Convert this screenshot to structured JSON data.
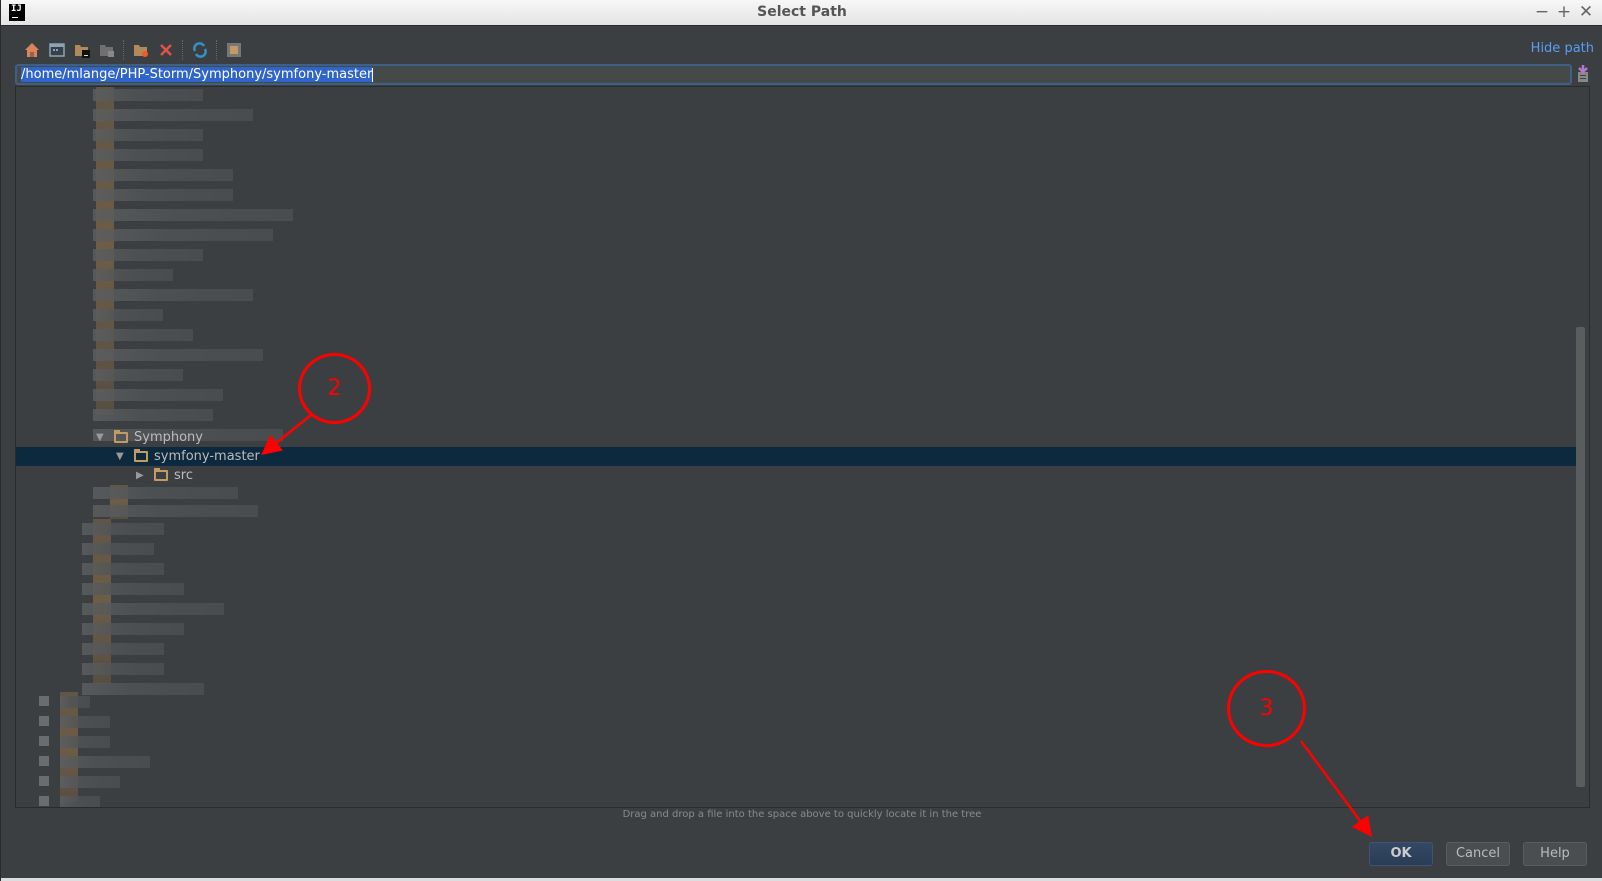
{
  "window": {
    "title": "Select Path",
    "app_icon": "intellij-logo-icon",
    "controls": [
      "minimize-icon",
      "maximize-icon",
      "close-icon"
    ]
  },
  "toolbar": {
    "buttons": [
      {
        "icon": "home-icon",
        "tooltip": ""
      },
      {
        "icon": "desktop-icon",
        "tooltip": ""
      },
      {
        "icon": "project-folder-icon",
        "tooltip": ""
      },
      {
        "icon": "module-folder-icon",
        "tooltip": ""
      },
      {
        "icon": "new-folder-icon",
        "tooltip": ""
      },
      {
        "icon": "delete-icon",
        "tooltip": ""
      },
      {
        "icon": "refresh-icon",
        "tooltip": ""
      },
      {
        "icon": "show-hidden-icon",
        "tooltip": ""
      }
    ],
    "hide_path_label": "Hide path"
  },
  "path_field": {
    "value": "/home/mlange/PHP-Storm/Symphony/symfony-master"
  },
  "tree": {
    "visible_nodes": [
      {
        "label": "Symphony",
        "expanded": true,
        "selected": false
      },
      {
        "label": "symfony-master",
        "expanded": true,
        "selected": true
      },
      {
        "label": "src",
        "expanded": false,
        "selected": false
      }
    ],
    "note": "other entries blurred"
  },
  "hint": "Drag and drop a file into the space above to quickly locate it in the tree",
  "buttons": {
    "ok": "OK",
    "cancel": "Cancel",
    "help": "Help"
  },
  "annotations": [
    {
      "number": "2",
      "target": "symfony-master"
    },
    {
      "number": "3",
      "target": "OK"
    }
  ],
  "colors": {
    "background": "#3c3f41",
    "selection": "#0d293e",
    "link": "#589df6",
    "folder": "#c39a62",
    "annotation": "#ff0000"
  }
}
